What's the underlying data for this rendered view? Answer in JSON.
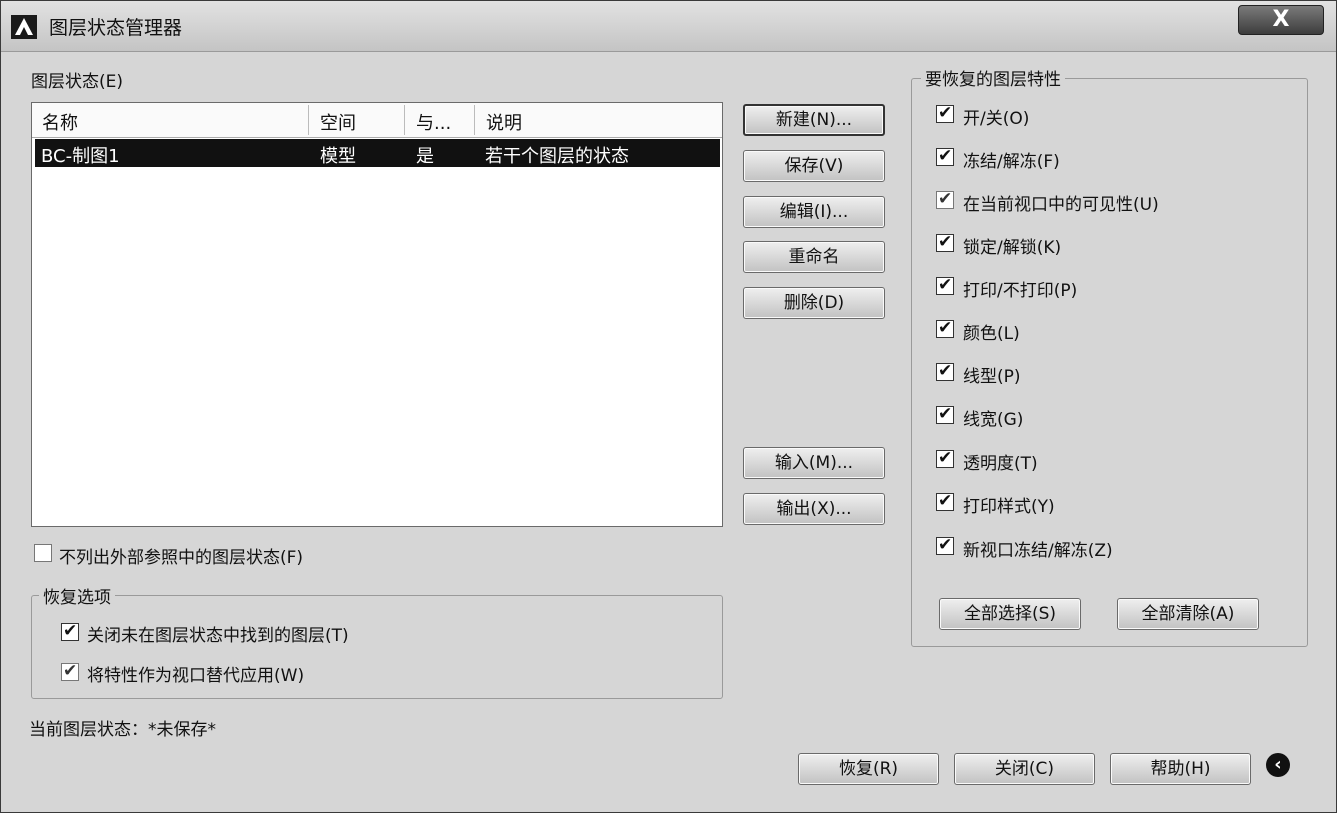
{
  "window": {
    "title": "图层状态管理器",
    "close_label": "X"
  },
  "states_label": "图层状态(E)",
  "table": {
    "columns": [
      "名称",
      "空间",
      "与...",
      "说明"
    ],
    "rows": [
      {
        "name": "BC-制图1",
        "space": "模型",
        "same": "是",
        "description": "若干个图层的状态"
      }
    ]
  },
  "buttons": {
    "new": "新建(N)...",
    "save": "保存(V)",
    "edit": "编辑(I)...",
    "rename": "重命名",
    "delete": "删除(D)",
    "import": "输入(M)...",
    "export": "输出(X)..."
  },
  "exclude_xref": {
    "label": "不列出外部参照中的图层状态(F)",
    "checked": false
  },
  "restore_options": {
    "title": "恢复选项",
    "items": [
      {
        "label": "关闭未在图层状态中找到的图层(T)",
        "checked": true
      },
      {
        "label": "将特性作为视口替代应用(W)",
        "checked": true
      }
    ]
  },
  "current_state": "当前图层状态：*未保存*",
  "properties": {
    "title": "要恢复的图层特性",
    "items": [
      {
        "label": "开/关(O)",
        "checked": true
      },
      {
        "label": "冻结/解冻(F)",
        "checked": true
      },
      {
        "label": "在当前视口中的可见性(U)",
        "checked": true
      },
      {
        "label": "锁定/解锁(K)",
        "checked": true
      },
      {
        "label": "打印/不打印(P)",
        "checked": true
      },
      {
        "label": "颜色(L)",
        "checked": true
      },
      {
        "label": "线型(P)",
        "checked": true
      },
      {
        "label": "线宽(G)",
        "checked": true
      },
      {
        "label": "透明度(T)",
        "checked": true
      },
      {
        "label": "打印样式(Y)",
        "checked": true
      },
      {
        "label": "新视口冻结/解冻(Z)",
        "checked": true
      }
    ],
    "select_all": "全部选择(S)",
    "clear_all": "全部清除(A)"
  },
  "footer": {
    "restore": "恢复(R)",
    "close": "关闭(C)",
    "help": "帮助(H)"
  },
  "icons": {
    "app": "autocad-logo-icon",
    "expand": "collapse-arrow-icon"
  }
}
